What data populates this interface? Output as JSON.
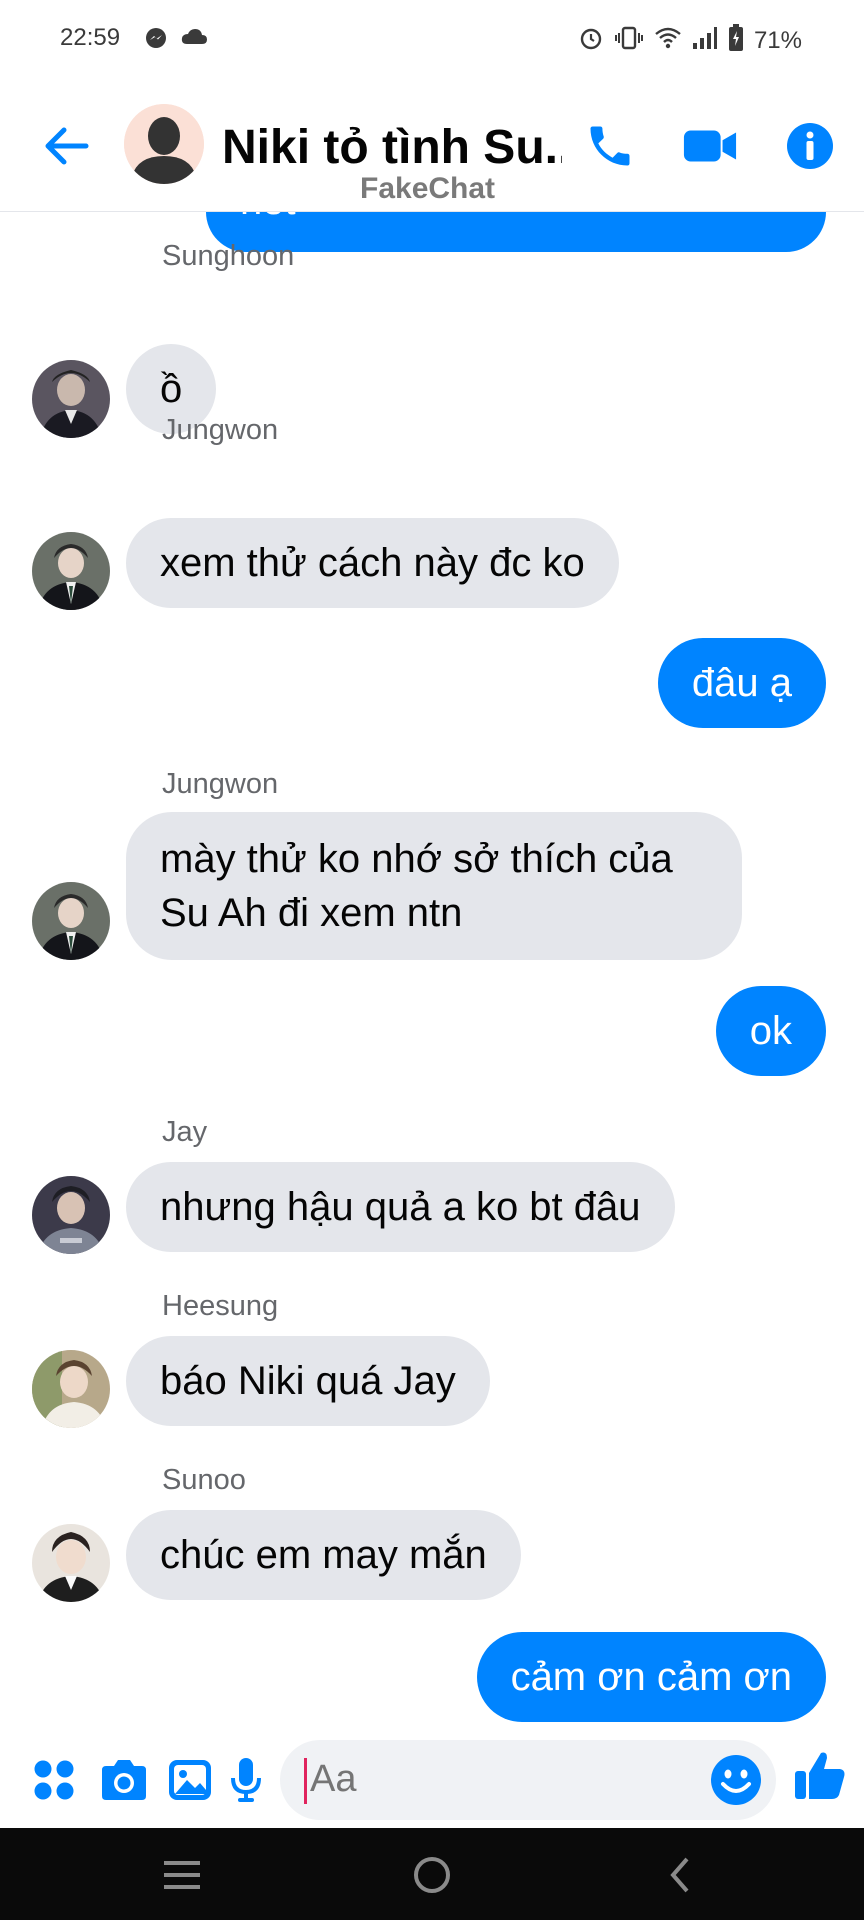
{
  "status_bar": {
    "time": "22:59",
    "battery_percent": "71%",
    "icons": [
      "messenger-icon",
      "cloud-icon",
      "alarm-icon",
      "vibrate-icon",
      "wifi-icon",
      "signal-icon",
      "battery-icon"
    ]
  },
  "header": {
    "title": "Niki tỏ tình Su...",
    "watermark": "FakeChat",
    "accent_color": "#0084ff"
  },
  "messages": [
    {
      "direction": "out",
      "text": "hết",
      "partially_visible": true
    },
    {
      "direction": "in",
      "sender": "Sunghoon",
      "text": "ồ"
    },
    {
      "direction": "in",
      "sender": "Jungwon",
      "text": "xem thử cách này đc ko"
    },
    {
      "direction": "out",
      "text": "đâu ạ"
    },
    {
      "direction": "in",
      "sender": "Jungwon",
      "text": "mày thử ko nhớ sở thích của Su Ah đi xem ntn"
    },
    {
      "direction": "out",
      "text": "ok"
    },
    {
      "direction": "in",
      "sender": "Jay",
      "text": "nhưng hậu quả a ko bt đâu"
    },
    {
      "direction": "in",
      "sender": "Heesung",
      "text": "báo Niki quá Jay"
    },
    {
      "direction": "in",
      "sender": "Sunoo",
      "text": "chúc em may mắn"
    },
    {
      "direction": "out",
      "text": "cảm ơn cảm ơn"
    }
  ],
  "composer": {
    "placeholder": "Aa"
  },
  "colors": {
    "outgoing_bubble": "#0084ff",
    "incoming_bubble": "#e4e6eb",
    "sender_name": "#65676b"
  }
}
